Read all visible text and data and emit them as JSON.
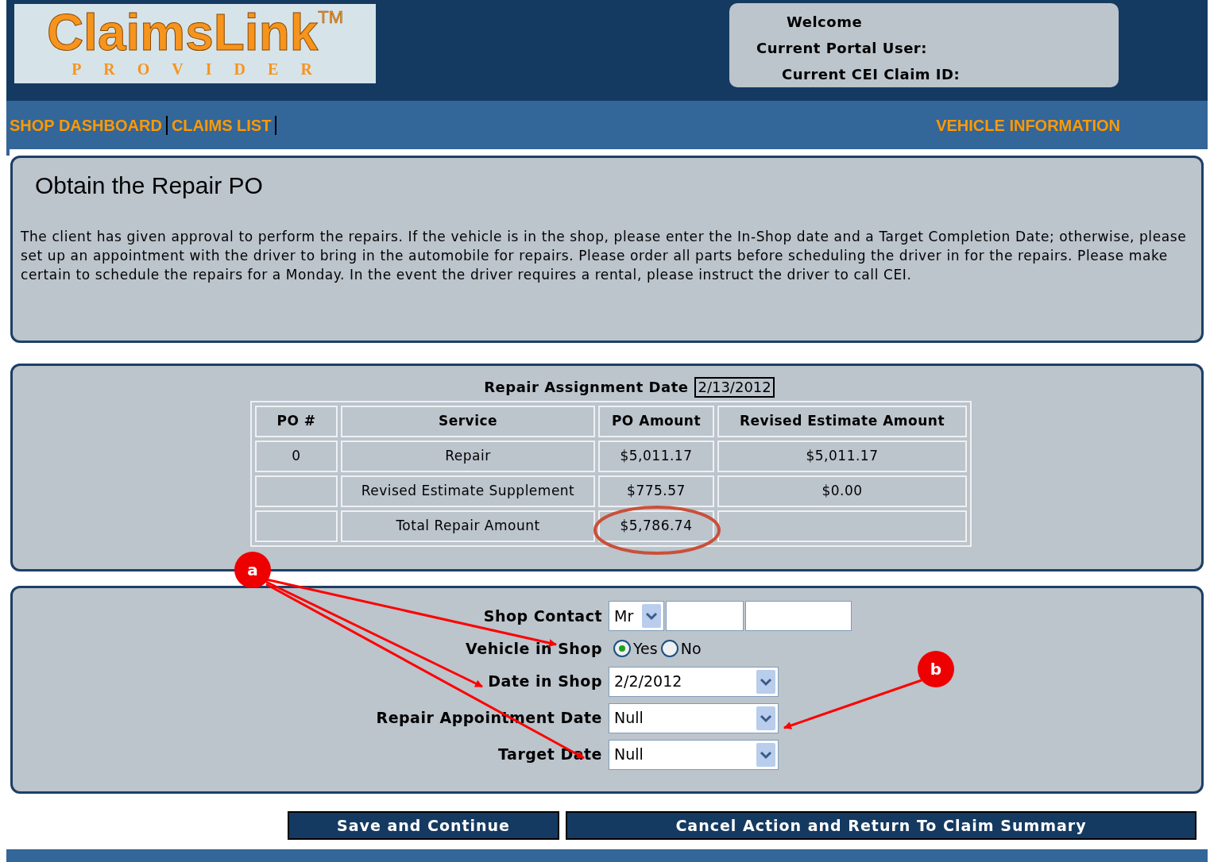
{
  "header": {
    "logo": {
      "name": "ClaimsLink",
      "trademark": "TM",
      "subtitle": "PROVIDER"
    },
    "welcome": [
      "Welcome",
      "Current Portal User:",
      "Current CEI Claim ID:"
    ]
  },
  "nav": {
    "left": [
      {
        "label": "SHOP DASHBOARD"
      },
      {
        "label": "CLAIMS LIST"
      }
    ],
    "right": [
      {
        "label": "VEHICLE INFORMATION"
      }
    ]
  },
  "intro": {
    "title": "Obtain the Repair PO",
    "text": "The client has given approval to perform the repairs. If the vehicle is in the shop, please enter the In-Shop date and a Target Completion Date; otherwise, please set up an appointment with the driver to bring in the automobile for repairs. Please order all parts before scheduling the driver in for the repairs. Please make certain to schedule the repairs for a Monday. In the event the driver requires a rental, please instruct the driver to call CEI."
  },
  "po": {
    "assignment_label": "Repair Assignment Date",
    "assignment_date": "2/13/2012",
    "columns": [
      "PO #",
      "Service",
      "PO Amount",
      "Revised Estimate Amount"
    ],
    "rows": [
      {
        "po": "0",
        "service": "Repair",
        "po_amount": "$5,011.17",
        "revised": "$5,011.17",
        "circled": false
      },
      {
        "service": "Revised Estimate Supplement",
        "po_amount": "$775.57",
        "revised": "$0.00",
        "circled": false
      },
      {
        "service": "Total Repair Amount",
        "po_amount": "$5,786.74",
        "circled": true
      }
    ]
  },
  "form": {
    "shop_contact": {
      "label": "Shop Contact",
      "title": "Mr"
    },
    "vehicle_in_shop": {
      "label": "Vehicle in Shop",
      "options": [
        {
          "label": "Yes",
          "selected": true
        },
        {
          "label": "No",
          "selected": false
        }
      ]
    },
    "dates": [
      {
        "label": "Date in Shop",
        "value": "2/2/2012"
      },
      {
        "label": "Repair Appointment Date",
        "value": "Null"
      },
      {
        "label": "Target Date",
        "value": "Null"
      }
    ]
  },
  "annotations": [
    {
      "label": "a"
    },
    {
      "label": "b"
    }
  ],
  "buttons": [
    "Save and Continue",
    "Cancel Action and Return To Claim Summary"
  ]
}
